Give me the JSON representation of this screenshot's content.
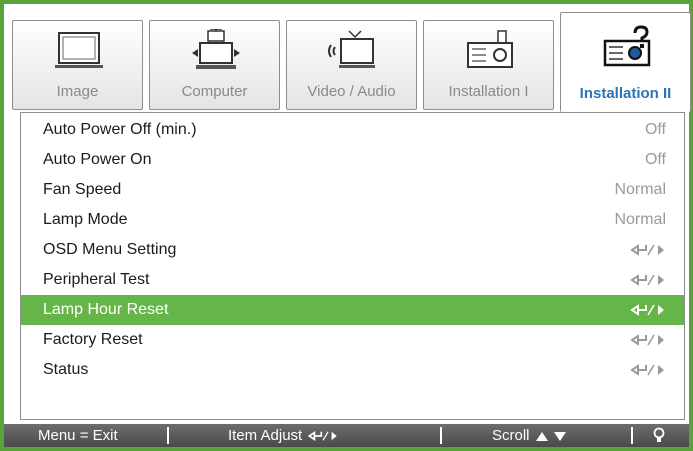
{
  "tabs": [
    {
      "label": "Image",
      "icon": "monitor-icon"
    },
    {
      "label": "Computer",
      "icon": "computer-icon"
    },
    {
      "label": "Video / Audio",
      "icon": "video-audio-icon"
    },
    {
      "label": "Installation I",
      "icon": "projector-icon"
    },
    {
      "label": "Installation II",
      "icon": "projector-help-icon",
      "active": true
    }
  ],
  "menu": {
    "items": [
      {
        "name": "Auto Power Off (min.)",
        "value": "Off"
      },
      {
        "name": "Auto Power On",
        "value": "Off"
      },
      {
        "name": "Fan Speed",
        "value": "Normal"
      },
      {
        "name": "Lamp Mode",
        "value": "Normal"
      },
      {
        "name": "OSD Menu Setting",
        "value": "",
        "icon": "enter-right-icon"
      },
      {
        "name": "Peripheral Test",
        "value": "",
        "icon": "enter-right-icon"
      },
      {
        "name": "Lamp Hour Reset",
        "value": "",
        "icon": "enter-right-icon",
        "selected": true
      },
      {
        "name": "Factory Reset",
        "value": "",
        "icon": "enter-right-icon"
      },
      {
        "name": "Status",
        "value": "",
        "icon": "enter-right-icon"
      }
    ]
  },
  "statusbar": {
    "menu_exit": "Menu = Exit",
    "item_adjust": "Item Adjust",
    "scroll": "Scroll"
  },
  "colors": {
    "accent_green": "#5aa33a",
    "selected_row": "#66b548",
    "active_tab_text": "#2a73b8"
  }
}
